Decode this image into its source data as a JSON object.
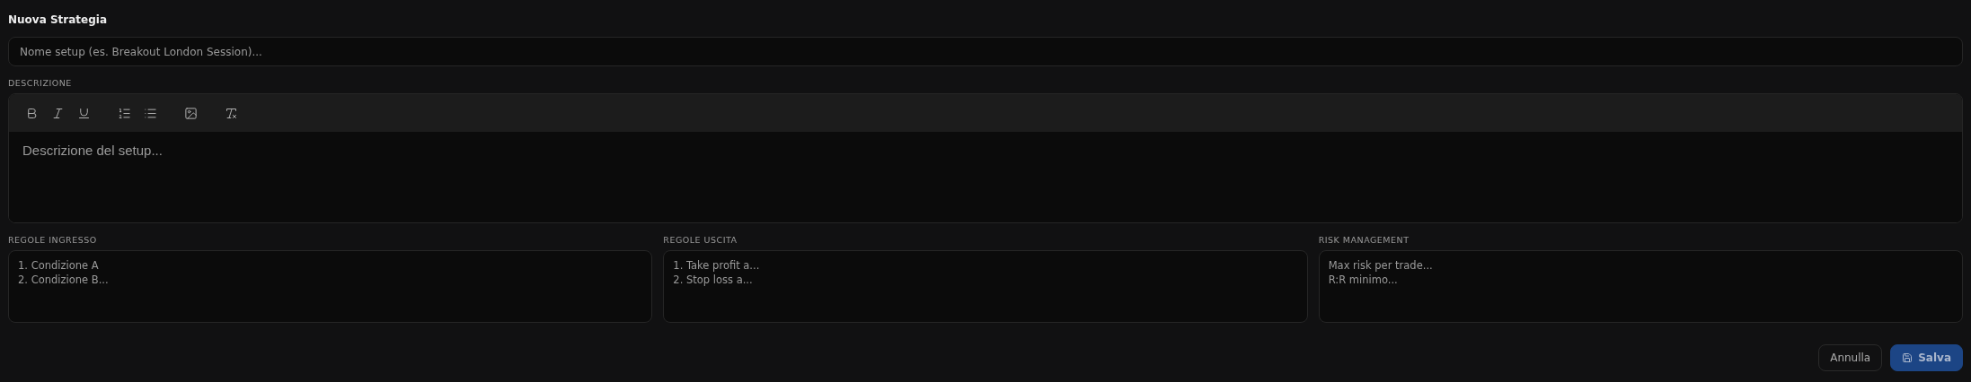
{
  "title": "Nuova Strategia",
  "name_field": {
    "placeholder": "Nome setup (es. Breakout London Session)..."
  },
  "description": {
    "label": "DESCRIZIONE",
    "toolbar": [
      {
        "kind": "bold"
      },
      {
        "kind": "italic"
      },
      {
        "kind": "underline"
      },
      {
        "kind": "ordered-list"
      },
      {
        "kind": "bullet-list"
      },
      {
        "kind": "image"
      },
      {
        "kind": "clear-format"
      }
    ],
    "placeholder": "Descrizione del setup..."
  },
  "rules": [
    {
      "label": "REGOLE INGRESSO",
      "placeholder": "1. Condizione A\n2. Condizione B..."
    },
    {
      "label": "REGOLE USCITA",
      "placeholder": "1. Take profit a...\n2. Stop loss a..."
    },
    {
      "label": "RISK MANAGEMENT",
      "placeholder": "Max risk per trade...\nR:R minimo..."
    }
  ],
  "buttons": [
    {
      "kind": "secondary",
      "label": "Annulla"
    },
    {
      "kind": "primary",
      "label": "Salva"
    }
  ]
}
